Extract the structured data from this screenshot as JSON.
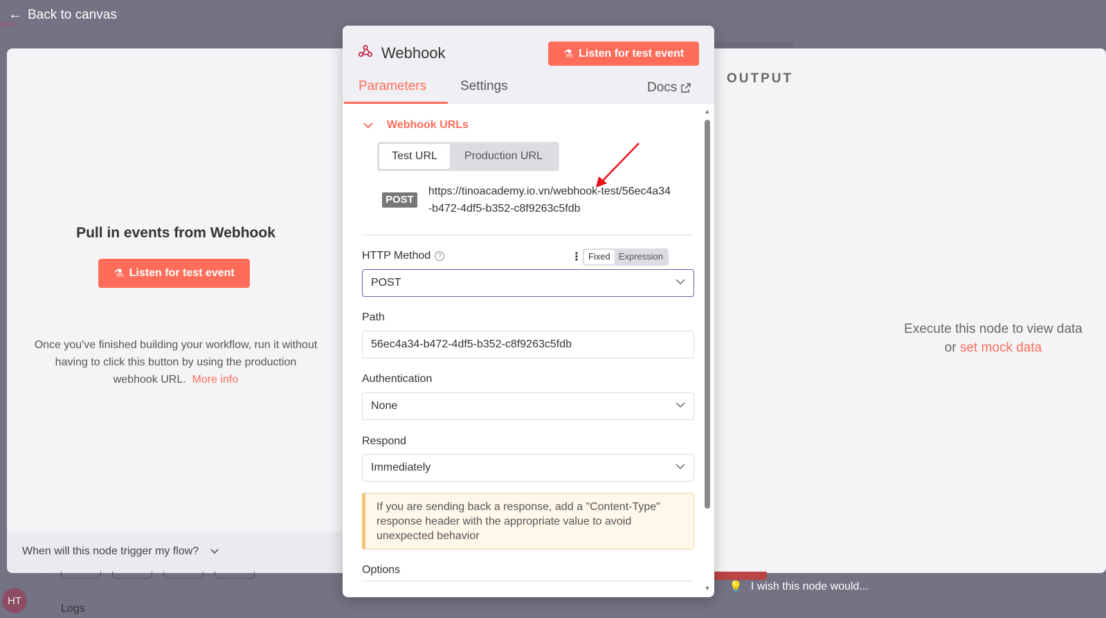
{
  "header": {
    "back_label": "Back to canvas"
  },
  "background": {
    "logs_label": "Logs",
    "avatar_initials": "HT",
    "wish_text": "I wish this node would..."
  },
  "input_pane": {
    "title": "Pull in events from Webhook",
    "listen_button": "Listen for test event",
    "description": "Once you've finished building your workflow, run it without having to click this button by using the production webhook URL.",
    "more_info": "More info",
    "trigger_question": "When will this node trigger my flow?"
  },
  "output_pane": {
    "label": "OUTPUT",
    "exec_text": "Execute this node to view data",
    "or_text": "or",
    "mock_link": "set mock data"
  },
  "modal": {
    "title": "Webhook",
    "listen_button": "Listen for test event",
    "tabs": [
      {
        "label": "Parameters",
        "active": true
      },
      {
        "label": "Settings",
        "active": false
      }
    ],
    "docs_label": "Docs",
    "webhook_urls": {
      "heading": "Webhook URLs",
      "test_tab": "Test URL",
      "prod_tab": "Production URL",
      "method_badge": "POST",
      "url": "https://tinoacademy.io.vn/webhook-test/56ec4a34-b472-4df5-b352-c8f9263c5fdb"
    },
    "http_method": {
      "label": "HTTP Method",
      "mode_fixed": "Fixed",
      "mode_expression": "Expression",
      "value": "POST"
    },
    "path": {
      "label": "Path",
      "value": "56ec4a34-b472-4df5-b352-c8f9263c5fdb"
    },
    "authentication": {
      "label": "Authentication",
      "value": "None"
    },
    "respond": {
      "label": "Respond",
      "value": "Immediately"
    },
    "notice": "If you are sending back a response, add a \"Content-Type\" response header with the appropriate value to avoid unexpected behavior",
    "options_label": "Options"
  },
  "colors": {
    "accent": "#ff6d5a",
    "focus_border": "#6b5ca5",
    "notice_bg": "#fef7ea"
  }
}
